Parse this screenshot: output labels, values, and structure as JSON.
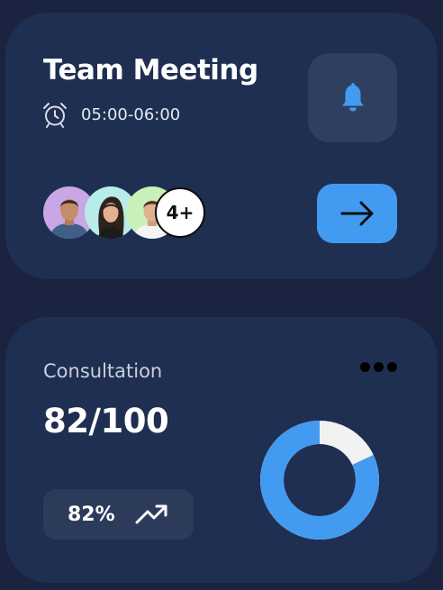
{
  "meeting": {
    "title": "Team Meeting",
    "time": "05:00-06:00",
    "more_attendees": "4+",
    "time_icon": "alarm-clock-icon",
    "notify_icon": "bell-icon",
    "action_icon": "arrow-right-icon"
  },
  "consultation": {
    "label": "Consultation",
    "score": "82/100",
    "percent_label": "82%",
    "percent_value": 82,
    "trend_icon": "trending-up-icon",
    "menu_icon": "more-dots-icon"
  },
  "colors": {
    "background": "#1a2340",
    "card": "#1f2f52",
    "accent": "#429bf0",
    "ring_remainder": "#f2f2f2"
  }
}
